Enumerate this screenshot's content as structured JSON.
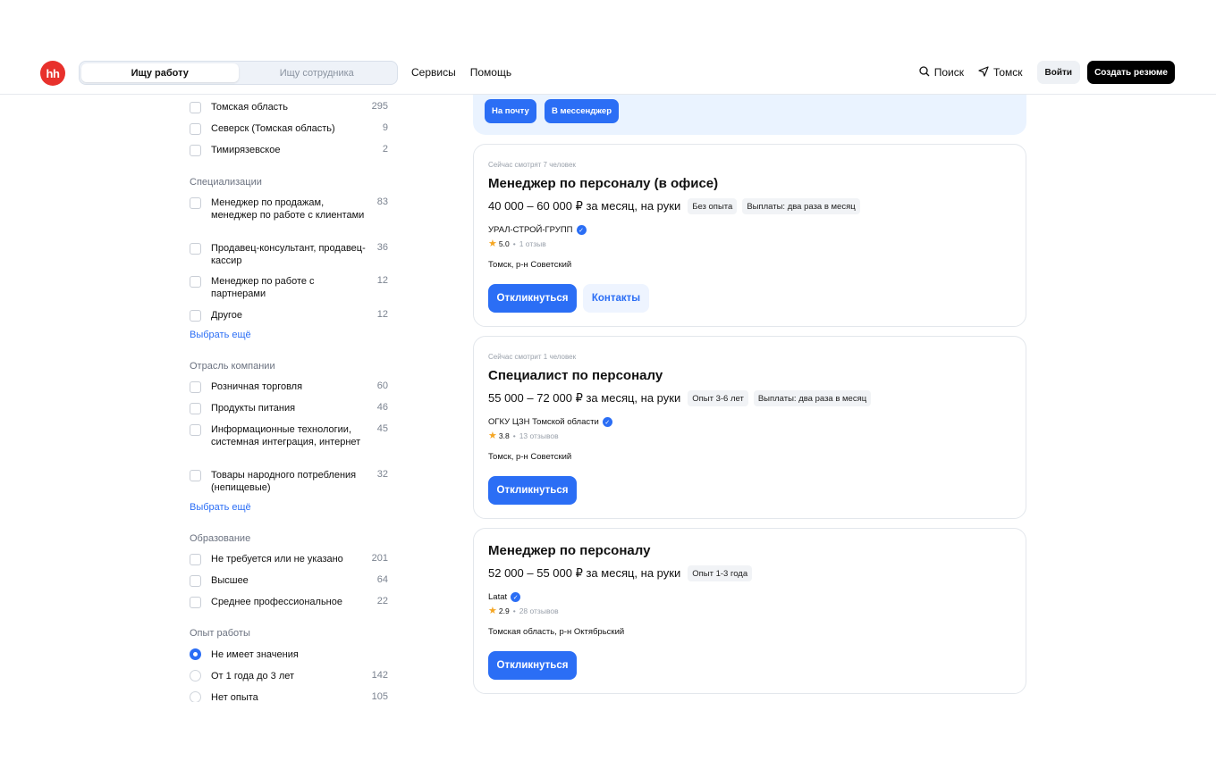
{
  "header": {
    "logo": "hh",
    "switch": {
      "seek_job": "Ищу работу",
      "seek_employee": "Ищу сотрудника"
    },
    "nav": [
      "Сервисы",
      "Помощь"
    ],
    "search_label": "Поиск",
    "city_label": "Томск",
    "login_label": "Войти",
    "create_resume_label": "Создать резюме"
  },
  "sidebar": {
    "region_items": [
      {
        "label": "Томская область",
        "count": "295"
      },
      {
        "label": "Северск (Томская область)",
        "count": "9"
      },
      {
        "label": "Тимирязевское",
        "count": "2"
      }
    ],
    "specializations": {
      "title": "Специализации",
      "items": [
        {
          "label": "Менеджер по продажам, менеджер по работе с клиентами",
          "count": "83"
        },
        {
          "label": "Продавец-консультант, продавец-кассир",
          "count": "36"
        },
        {
          "label": "Менеджер по работе с партнерами",
          "count": "12"
        },
        {
          "label": "Другое",
          "count": "12"
        }
      ],
      "more": "Выбрать ещё"
    },
    "industry": {
      "title": "Отрасль компании",
      "items": [
        {
          "label": "Розничная торговля",
          "count": "60"
        },
        {
          "label": "Продукты питания",
          "count": "46"
        },
        {
          "label": "Информационные технологии, системная интеграция, интернет",
          "count": "45"
        },
        {
          "label": "Товары народного потребления (непищевые)",
          "count": "32"
        }
      ],
      "more": "Выбрать ещё"
    },
    "education": {
      "title": "Образование",
      "items": [
        {
          "label": "Не требуется или не указано",
          "count": "201"
        },
        {
          "label": "Высшее",
          "count": "64"
        },
        {
          "label": "Среднее профессиональное",
          "count": "22"
        }
      ]
    },
    "experience": {
      "title": "Опыт работы",
      "items": [
        {
          "label": "Не имеет значения",
          "count": ""
        },
        {
          "label": "От 1 года до 3 лет",
          "count": "142"
        },
        {
          "label": "Нет опыта",
          "count": "105"
        }
      ]
    }
  },
  "promo": {
    "email_btn": "На почту",
    "messenger_btn": "В мессенджер"
  },
  "vacancies": [
    {
      "viewers": "Сейчас смотрят 7 человек",
      "title": "Менеджер по персоналу (в офисе)",
      "salary": "40 000 – 60 000 ₽ за месяц, на руки",
      "tags": [
        "Без опыта",
        "Выплаты: два раза в месяц"
      ],
      "company": "УРАЛ-СТРОЙ-ГРУПП",
      "rating": "5.0",
      "reviews": "1 отзыв",
      "location": "Томск, р-н Советский",
      "apply": "Откликнуться",
      "contacts": "Контакты"
    },
    {
      "viewers": "Сейчас смотрит 1 человек",
      "title": "Специалист по персоналу",
      "salary": "55 000 – 72 000 ₽ за месяц, на руки",
      "tags": [
        "Опыт 3-6 лет",
        "Выплаты: два раза в месяц"
      ],
      "company": "ОГКУ ЦЗН Томской области",
      "rating": "3.8",
      "reviews": "13 отзывов",
      "location": "Томск, р-н Советский",
      "apply": "Откликнуться"
    },
    {
      "title": "Менеджер по персоналу",
      "salary": "52 000 – 55 000 ₽ за месяц, на руки",
      "tags": [
        "Опыт 1-3 года"
      ],
      "company": "Latat",
      "rating": "2.9",
      "reviews": "28 отзывов",
      "location": "Томская область, р-н Октябрьский",
      "apply": "Откликнуться"
    }
  ]
}
